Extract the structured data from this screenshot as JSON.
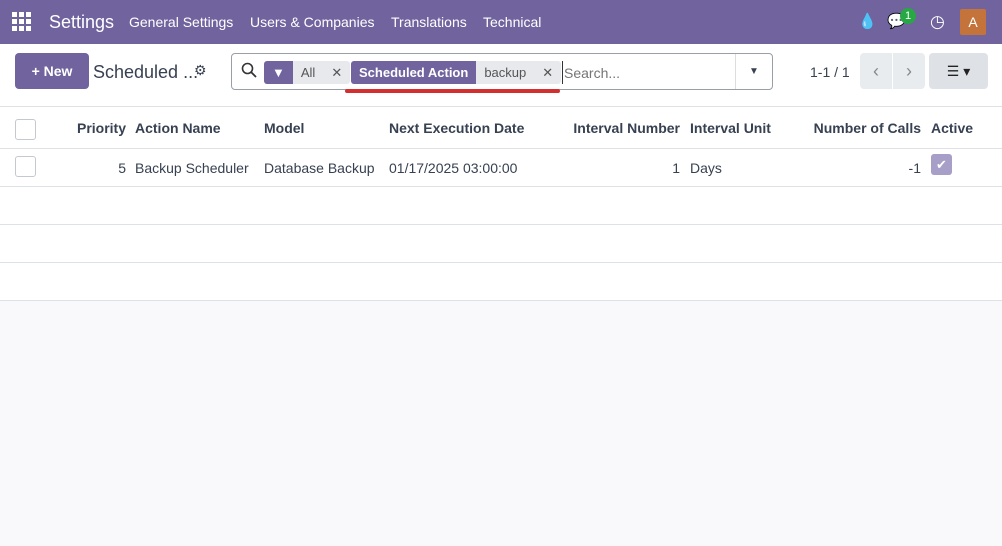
{
  "nav": {
    "app": "Settings",
    "menus": [
      "General Settings",
      "Users & Companies",
      "Translations",
      "Technical"
    ],
    "chat_badge": "1",
    "avatar": "A"
  },
  "control": {
    "new_label": "New",
    "breadcrumb": "Scheduled ...",
    "facets": [
      {
        "label": "All"
      },
      {
        "label": "Scheduled Action",
        "value": "backup"
      }
    ],
    "search_placeholder": "Search...",
    "pager": "1-1 / 1"
  },
  "table": {
    "headers": [
      "Priority",
      "Action Name",
      "Model",
      "Next Execution Date",
      "Interval Number",
      "Interval Unit",
      "Number of Calls",
      "Active"
    ],
    "rows": [
      {
        "priority": "5",
        "name": "Backup Scheduler",
        "model": "Database Backup",
        "next": "01/17/2025 03:00:00",
        "interval_number": "1",
        "interval_unit": "Days",
        "calls": "-1",
        "active": true
      }
    ]
  },
  "colors": {
    "brand": "#71639e",
    "highlight": "#d32f2f",
    "avatar": "#c4743a",
    "badge": "#28a745"
  }
}
